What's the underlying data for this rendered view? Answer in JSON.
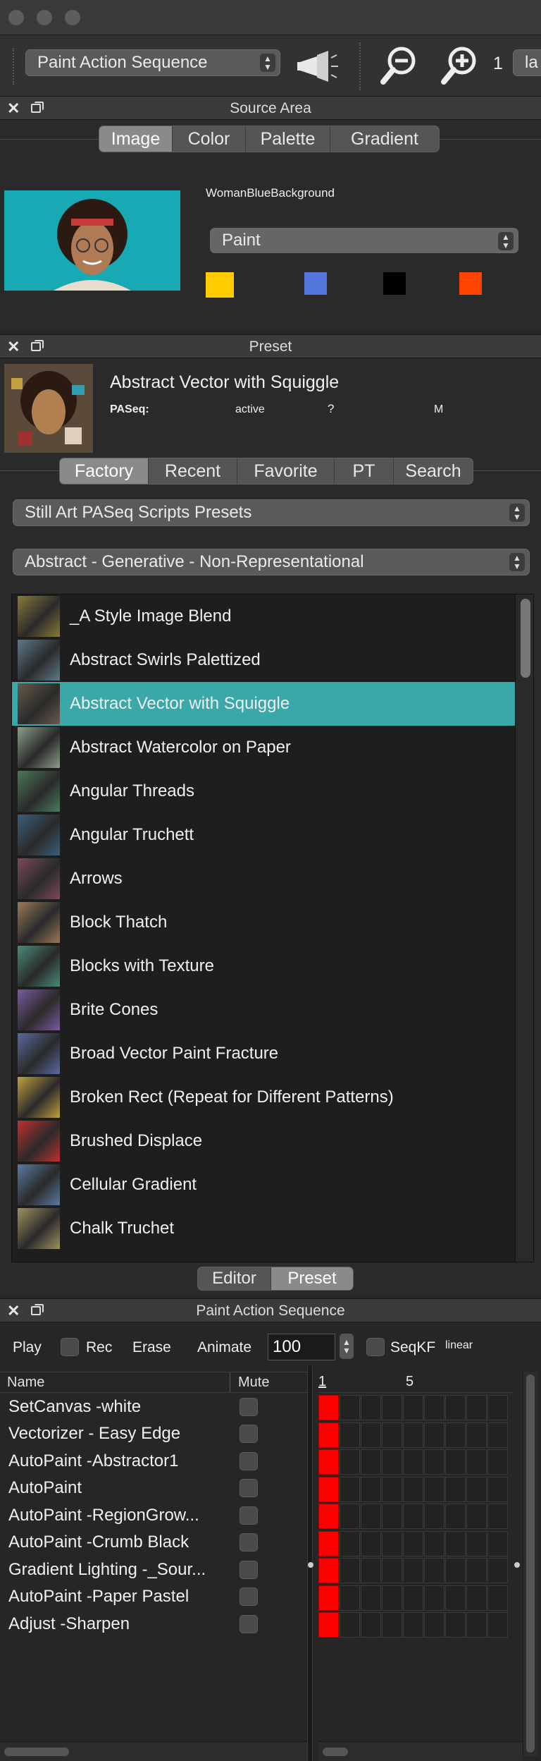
{
  "toolbar": {
    "sequence_select": "Paint Action Sequence",
    "zoom_value": "1",
    "layer_select_partial": "la"
  },
  "source_area": {
    "title": "Source Area",
    "tabs": [
      "Image",
      "Color",
      "Palette",
      "Gradient"
    ],
    "active_tab": "Image",
    "image_name": "WomanBlueBackground",
    "mode_select": "Paint",
    "swatches": [
      "#ffcc00",
      "#5577dd",
      "#000000",
      "#ff4400"
    ]
  },
  "preset": {
    "title": "Preset",
    "current_name": "Abstract Vector with Squiggle",
    "meta": {
      "paseq_label": "PASeq:",
      "status": "active",
      "help": "?",
      "m": "M"
    },
    "tabs": [
      "Factory",
      "Recent",
      "Favorite",
      "PT",
      "Search"
    ],
    "active_tab": "Factory",
    "category_select": "Still Art PASeq Scripts Presets",
    "subcategory_select": "Abstract - Generative - Non-Representational",
    "items": [
      {
        "label": "_A Style Image Blend",
        "color": "#8a7a3a"
      },
      {
        "label": "Abstract Swirls Palettized",
        "color": "#5f7a8a"
      },
      {
        "label": "Abstract Vector with Squiggle",
        "color": "#6a5a4a",
        "selected": true
      },
      {
        "label": "Abstract Watercolor on Paper",
        "color": "#8aa08a"
      },
      {
        "label": "Angular Threads",
        "color": "#4a7a5a"
      },
      {
        "label": "Angular Truchett",
        "color": "#3a5f7a"
      },
      {
        "label": "Arrows",
        "color": "#7a4a5a"
      },
      {
        "label": "Block Thatch",
        "color": "#9a7a5a"
      },
      {
        "label": "Blocks with Texture",
        "color": "#4a8a7a"
      },
      {
        "label": "Brite Cones",
        "color": "#7a5aa0"
      },
      {
        "label": "Broad Vector Paint Fracture",
        "color": "#5a6aa0"
      },
      {
        "label": "Broken Rect (Repeat for Different Patterns)",
        "color": "#c0a040"
      },
      {
        "label": "Brushed Displace",
        "color": "#c03030"
      },
      {
        "label": "Cellular Gradient",
        "color": "#5a7aa0"
      },
      {
        "label": "Chalk Truchet",
        "color": "#a09060"
      }
    ],
    "bottom_tabs": [
      "Editor",
      "Preset"
    ],
    "bottom_active": "Preset"
  },
  "sequence": {
    "title": "Paint Action Sequence",
    "controls": {
      "play": "Play",
      "rec": "Rec",
      "erase": "Erase",
      "animate": "Animate",
      "animate_value": "100",
      "seqkf": "SeqKF",
      "interp": "linear"
    },
    "columns": {
      "name": "Name",
      "mute": "Mute"
    },
    "frame_labels": [
      "1",
      "5"
    ],
    "actions": [
      "SetCanvas -white",
      "Vectorizer - Easy Edge",
      "AutoPaint -Abstractor1",
      "AutoPaint",
      "AutoPaint -RegionGrow...",
      "AutoPaint -Crumb Black",
      "Gradient Lighting -_Sour...",
      "AutoPaint -Paper Pastel",
      "Adjust -Sharpen"
    ]
  },
  "colors": {
    "accent_selection": "#3aa7a8",
    "keyframe_red": "#ff0000"
  }
}
